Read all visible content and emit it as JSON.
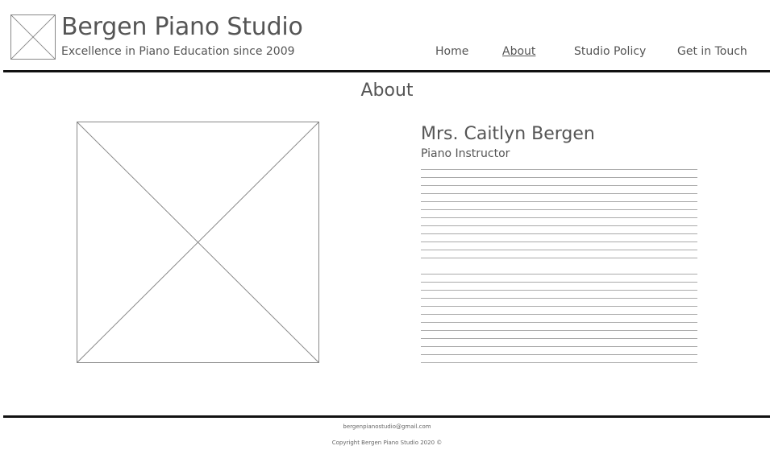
{
  "header": {
    "logo_icon": "image-placeholder-icon",
    "title": "Bergen Piano Studio",
    "tagline": "Excellence in Piano Education since 2009",
    "nav": {
      "home": "Home",
      "about": "About",
      "policy": "Studio Policy",
      "contact": "Get in Touch"
    }
  },
  "main": {
    "heading": "About",
    "photo_icon": "image-placeholder-icon",
    "instructor": {
      "name": "Mrs. Caitlyn Bergen",
      "role": "Piano Instructor"
    }
  },
  "footer": {
    "email": "bergenpianostudio@gmail.com",
    "copyright": "Copyright Bergen Piano Studio 2020 ©"
  },
  "colors": {
    "text": "#555555",
    "rule": "#111111",
    "placeholder": "#888888"
  }
}
